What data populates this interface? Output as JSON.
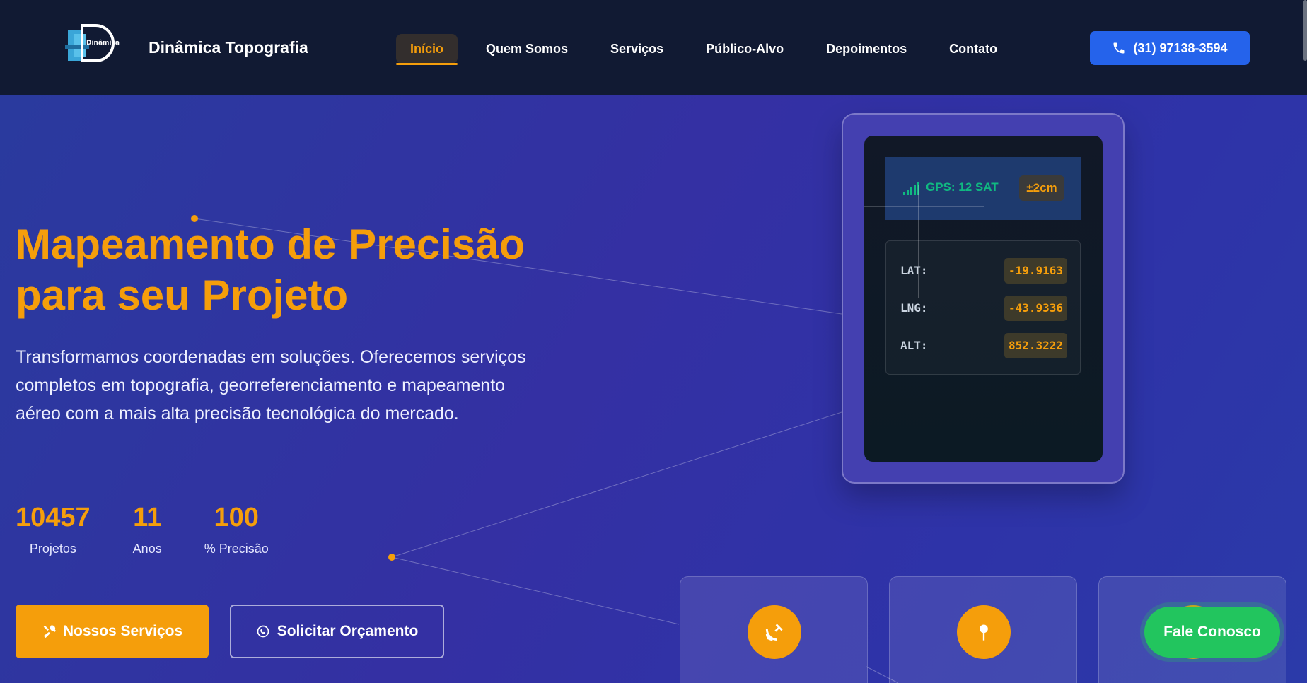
{
  "header": {
    "logo_alt": "Dinâmica",
    "brand": "Dinâmica Topografia",
    "nav": [
      {
        "label": "Início",
        "active": true
      },
      {
        "label": "Quem Somos",
        "active": false
      },
      {
        "label": "Serviços",
        "active": false
      },
      {
        "label": "Público-Alvo",
        "active": false
      },
      {
        "label": "Depoimentos",
        "active": false
      },
      {
        "label": "Contato",
        "active": false
      }
    ],
    "phone": "(31) 97138-3594",
    "phone_icon": "phone-icon"
  },
  "hero": {
    "title_line1": "Mapeamento de Precisão",
    "title_line2": "para seu Projeto",
    "description": "Transformamos coordenadas em soluções. Oferecemos serviços completos em topografia, georreferenciamento e mapeamento aéreo com a mais alta precisão tecnológica do mercado.",
    "stats": [
      {
        "value": "10457",
        "label": "Projetos"
      },
      {
        "value": "11",
        "label": "Anos"
      },
      {
        "value": "100",
        "label": "% Precisão"
      }
    ],
    "primary_button": "Nossos Serviços",
    "secondary_button": "Solicitar Orçamento"
  },
  "device": {
    "gps_status": "GPS: 12 SAT",
    "accuracy": "±2cm",
    "coords": [
      {
        "label": "LAT:",
        "value": "-19.9163"
      },
      {
        "label": "LNG:",
        "value": "-43.9336"
      },
      {
        "label": "ALT:",
        "value": "852.3222"
      }
    ]
  },
  "cards": [
    {
      "icon": "satellite-dish-icon"
    },
    {
      "icon": "map-pin-icon"
    },
    {
      "icon": "card-icon"
    }
  ],
  "fab": {
    "label": "Fale Conosco"
  },
  "colors": {
    "accent": "#f59e0b",
    "nav_bg": "#111a33",
    "phone_btn": "#2563eb",
    "fab": "#22c55e",
    "gps_green": "#10b981"
  }
}
